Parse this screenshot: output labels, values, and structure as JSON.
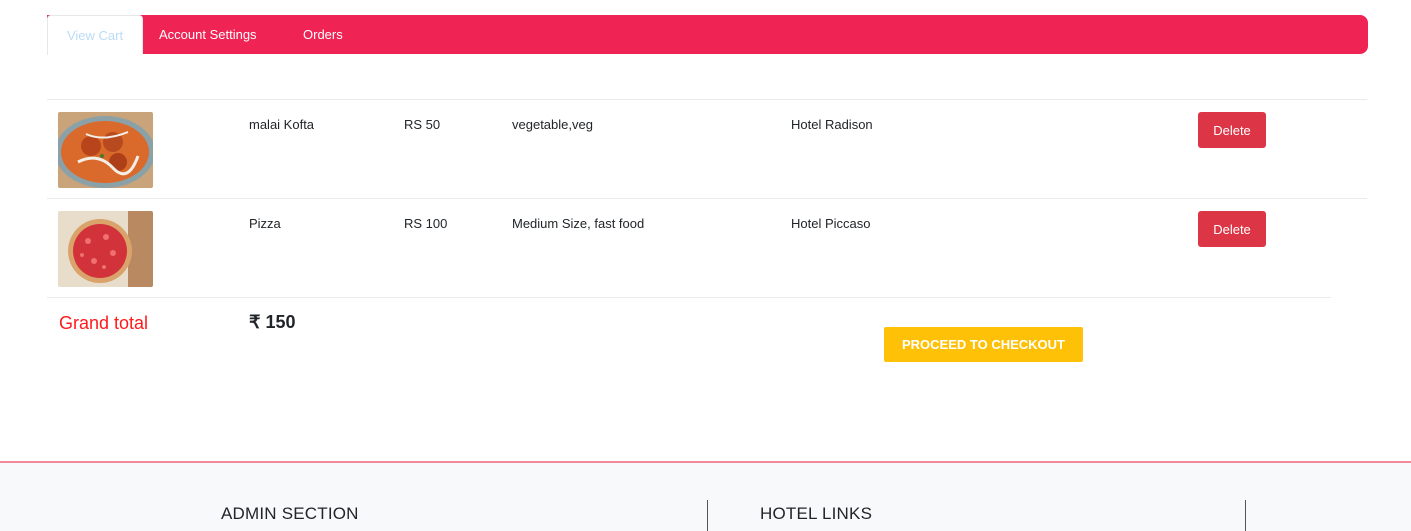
{
  "tabs": [
    {
      "label": "View Cart",
      "active": true
    },
    {
      "label": "Account Settings",
      "active": false
    },
    {
      "label": "Orders",
      "active": false
    }
  ],
  "cart": {
    "items": [
      {
        "name": "malai Kofta",
        "price": "RS 50",
        "description": "vegetable,veg",
        "hotel": "Hotel Radison",
        "action": "Delete",
        "image": "malai-kofta-image"
      },
      {
        "name": "Pizza",
        "price": "RS 100",
        "description": "Medium Size, fast food",
        "hotel": "Hotel Piccaso",
        "action": "Delete",
        "image": "pizza-image"
      }
    ],
    "grand_total_label": "Grand total",
    "grand_total_value": "₹ 150",
    "checkout_label": "PROCEED TO CHECKOUT"
  },
  "footer": {
    "admin_heading": "ADMIN SECTION",
    "hotel_heading": "HOTEL LINKS"
  },
  "colors": {
    "nav_bg": "#ef2354",
    "delete_bg": "#dc3545",
    "checkout_bg": "#ffc107",
    "grand_total_label": "#ff1a1a"
  }
}
